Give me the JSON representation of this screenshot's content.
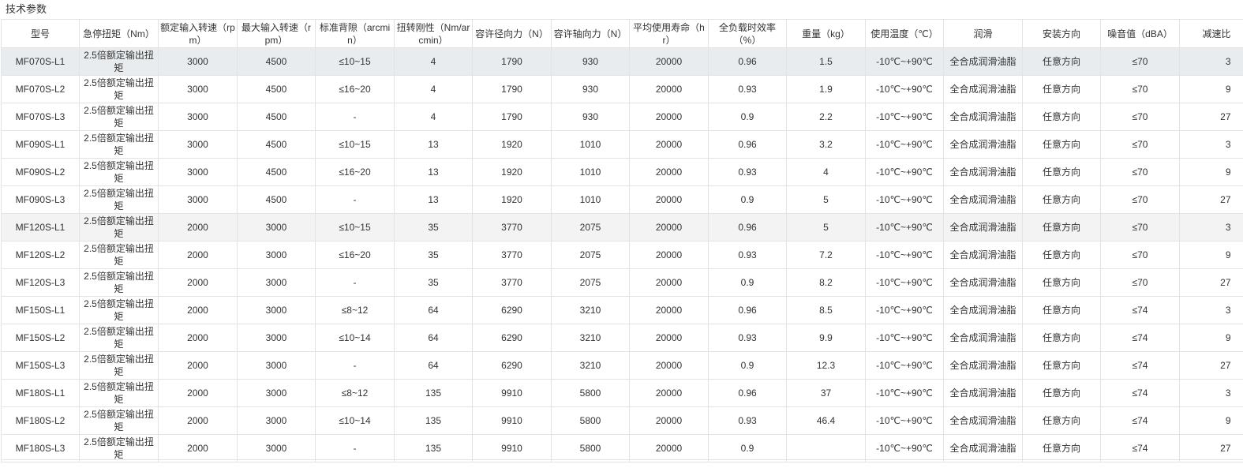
{
  "section_title": "技术参数",
  "columns": [
    "型号",
    "急停扭矩（Nm）",
    "额定输入转速（rpm）",
    "最大输入转速（rpm）",
    "标准背隙（arcmin）",
    "扭转刚性（Nm/arcmin）",
    "容许径向力（N）",
    "容许轴向力（N）",
    "平均使用寿命（hr）",
    "全负载时效率（%）",
    "重量（kg）",
    "使用温度（℃）",
    "润滑",
    "安装方向",
    "噪音值（dBA）",
    "减速比"
  ],
  "rows": [
    [
      "MF070S-L1",
      "2.5倍额定输出扭矩",
      "3000",
      "4500",
      "≤10~15",
      "4",
      "1790",
      "930",
      "20000",
      "0.96",
      "1.5",
      "-10℃~+90℃",
      "全合成润滑油脂",
      "任意方向",
      "≤70",
      "3"
    ],
    [
      "MF070S-L2",
      "2.5倍额定输出扭矩",
      "3000",
      "4500",
      "≤16~20",
      "4",
      "1790",
      "930",
      "20000",
      "0.93",
      "1.9",
      "-10℃~+90℃",
      "全合成润滑油脂",
      "任意方向",
      "≤70",
      "9"
    ],
    [
      "MF070S-L3",
      "2.5倍额定输出扭矩",
      "3000",
      "4500",
      "-",
      "4",
      "1790",
      "930",
      "20000",
      "0.9",
      "2.2",
      "-10℃~+90℃",
      "全合成润滑油脂",
      "任意方向",
      "≤70",
      "27"
    ],
    [
      "MF090S-L1",
      "2.5倍额定输出扭矩",
      "3000",
      "4500",
      "≤10~15",
      "13",
      "1920",
      "1010",
      "20000",
      "0.96",
      "3.2",
      "-10℃~+90℃",
      "全合成润滑油脂",
      "任意方向",
      "≤70",
      "3"
    ],
    [
      "MF090S-L2",
      "2.5倍额定输出扭矩",
      "3000",
      "4500",
      "≤16~20",
      "13",
      "1920",
      "1010",
      "20000",
      "0.93",
      "4",
      "-10℃~+90℃",
      "全合成润滑油脂",
      "任意方向",
      "≤70",
      "9"
    ],
    [
      "MF090S-L3",
      "2.5倍额定输出扭矩",
      "3000",
      "4500",
      "-",
      "13",
      "1920",
      "1010",
      "20000",
      "0.9",
      "5",
      "-10℃~+90℃",
      "全合成润滑油脂",
      "任意方向",
      "≤70",
      "27"
    ],
    [
      "MF120S-L1",
      "2.5倍额定输出扭矩",
      "2000",
      "3000",
      "≤10~15",
      "35",
      "3770",
      "2075",
      "20000",
      "0.96",
      "5",
      "-10℃~+90℃",
      "全合成润滑油脂",
      "任意方向",
      "≤70",
      "3"
    ],
    [
      "MF120S-L2",
      "2.5倍额定输出扭矩",
      "2000",
      "3000",
      "≤16~20",
      "35",
      "3770",
      "2075",
      "20000",
      "0.93",
      "7.2",
      "-10℃~+90℃",
      "全合成润滑油脂",
      "任意方向",
      "≤70",
      "9"
    ],
    [
      "MF120S-L3",
      "2.5倍额定输出扭矩",
      "2000",
      "3000",
      "-",
      "35",
      "3770",
      "2075",
      "20000",
      "0.9",
      "8.2",
      "-10℃~+90℃",
      "全合成润滑油脂",
      "任意方向",
      "≤70",
      "27"
    ],
    [
      "MF150S-L1",
      "2.5倍额定输出扭矩",
      "2000",
      "3000",
      "≤8~12",
      "64",
      "6290",
      "3210",
      "20000",
      "0.96",
      "8.5",
      "-10℃~+90℃",
      "全合成润滑油脂",
      "任意方向",
      "≤74",
      "3"
    ],
    [
      "MF150S-L2",
      "2.5倍额定输出扭矩",
      "2000",
      "3000",
      "≤10~14",
      "64",
      "6290",
      "3210",
      "20000",
      "0.93",
      "9.9",
      "-10℃~+90℃",
      "全合成润滑油脂",
      "任意方向",
      "≤74",
      "9"
    ],
    [
      "MF150S-L3",
      "2.5倍额定输出扭矩",
      "2000",
      "3000",
      "-",
      "64",
      "6290",
      "3210",
      "20000",
      "0.9",
      "12.3",
      "-10℃~+90℃",
      "全合成润滑油脂",
      "任意方向",
      "≤74",
      "27"
    ],
    [
      "MF180S-L1",
      "2.5倍额定输出扭矩",
      "2000",
      "3000",
      "≤8~12",
      "135",
      "9910",
      "5800",
      "20000",
      "0.96",
      "37",
      "-10℃~+90℃",
      "全合成润滑油脂",
      "任意方向",
      "≤74",
      "3"
    ],
    [
      "MF180S-L2",
      "2.5倍额定输出扭矩",
      "2000",
      "3000",
      "≤10~14",
      "135",
      "9910",
      "5800",
      "20000",
      "0.93",
      "46.4",
      "-10℃~+90℃",
      "全合成润滑油脂",
      "任意方向",
      "≤74",
      "9"
    ],
    [
      "MF180S-L3",
      "2.5倍额定输出扭矩",
      "2000",
      "3000",
      "-",
      "135",
      "9910",
      "5800",
      "20000",
      "0.9",
      "",
      "-10℃~+90℃",
      "全合成润滑油脂",
      "任意方向",
      "≤74",
      "27"
    ]
  ],
  "colors": {
    "border": "#e3e3e3",
    "text": "#333333",
    "highlight_row_1": "#e9ecee",
    "highlight_row_7": "#f3f3f3"
  }
}
